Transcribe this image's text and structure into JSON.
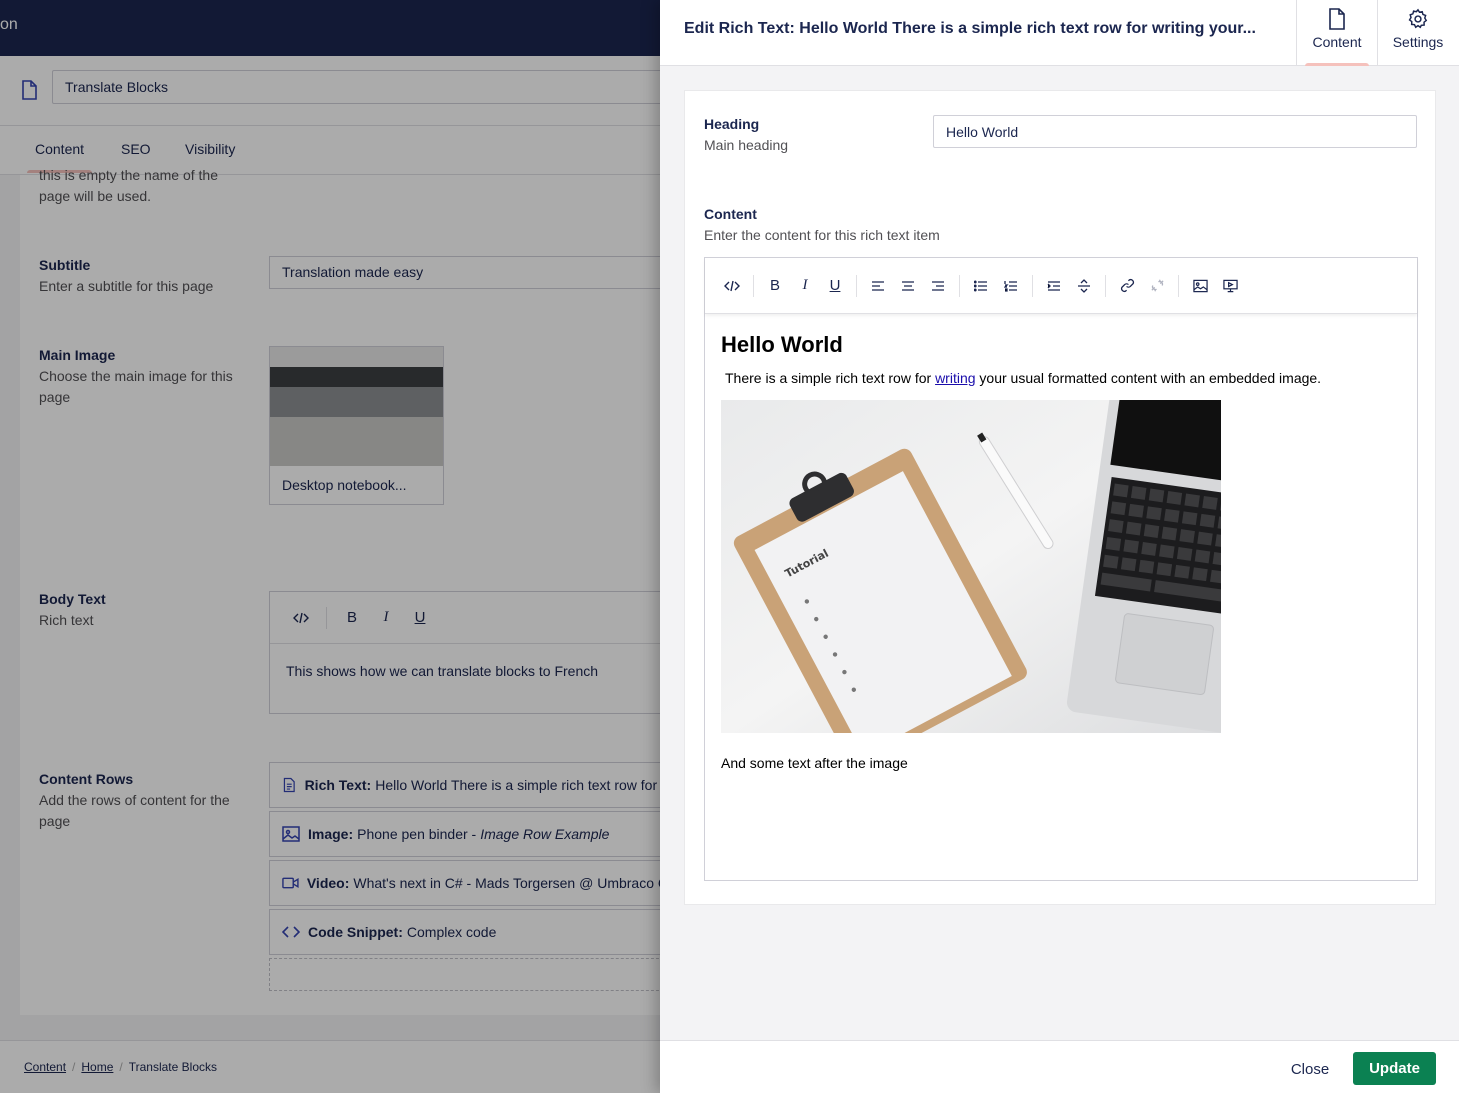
{
  "background": {
    "topbar_text": "on",
    "name_value": "Translate Blocks",
    "tabs": [
      {
        "label": "Content"
      },
      {
        "label": "SEO"
      },
      {
        "label": "Visibility"
      }
    ],
    "fields": {
      "title_desc_tail": "this is empty the name of the page will be used.",
      "subtitle": {
        "label": "Subtitle",
        "desc": "Enter a subtitle for this page",
        "value": "Translation made easy"
      },
      "main_image": {
        "label": "Main Image",
        "desc": "Choose the main image for this page",
        "caption": "Desktop notebook..."
      },
      "body_text": {
        "label": "Body Text",
        "desc": "Rich text",
        "value": "This shows how we can translate blocks to French"
      },
      "content_rows": {
        "label": "Content Rows",
        "desc": "Add the rows of content for the page",
        "items": [
          {
            "type": "Rich Text:",
            "text": "Hello World There is a simple rich text row for v",
            "icon": "document-icon"
          },
          {
            "type": "Image:",
            "text": "Phone pen binder -",
            "italic": "Image Row Example",
            "icon": "picture-icon"
          },
          {
            "type": "Video:",
            "text": "What's next in C# - Mads Torgersen @ Umbraco C",
            "icon": "video-icon"
          },
          {
            "type": "Code Snippet:",
            "text": "Complex code",
            "icon": "code-icon"
          }
        ]
      }
    },
    "breadcrumb": [
      "Content",
      "Home",
      "Translate Blocks"
    ]
  },
  "panel": {
    "title": "Edit Rich Text: Hello World There is a simple rich text row for writing your...",
    "tabs": [
      {
        "label": "Content",
        "icon": "document-icon",
        "active": true
      },
      {
        "label": "Settings",
        "icon": "gear-icon",
        "active": false
      }
    ],
    "heading": {
      "label": "Heading",
      "desc": "Main heading",
      "value": "Hello World"
    },
    "content": {
      "label": "Content",
      "desc": "Enter the content for this rich text item",
      "rte": {
        "heading": "Hello World",
        "para_before": "There is a simple rich text row for ",
        "link": "writing",
        "para_after": " your usual formatted content with an embedded image.",
        "after_image": "And some text after the image"
      }
    },
    "footer": {
      "close_label": "Close",
      "update_label": "Update"
    },
    "colors": {
      "primary_button": "#0b8152",
      "header_dark": "#1b264f",
      "tab_accent": "#f5c1bc"
    }
  }
}
